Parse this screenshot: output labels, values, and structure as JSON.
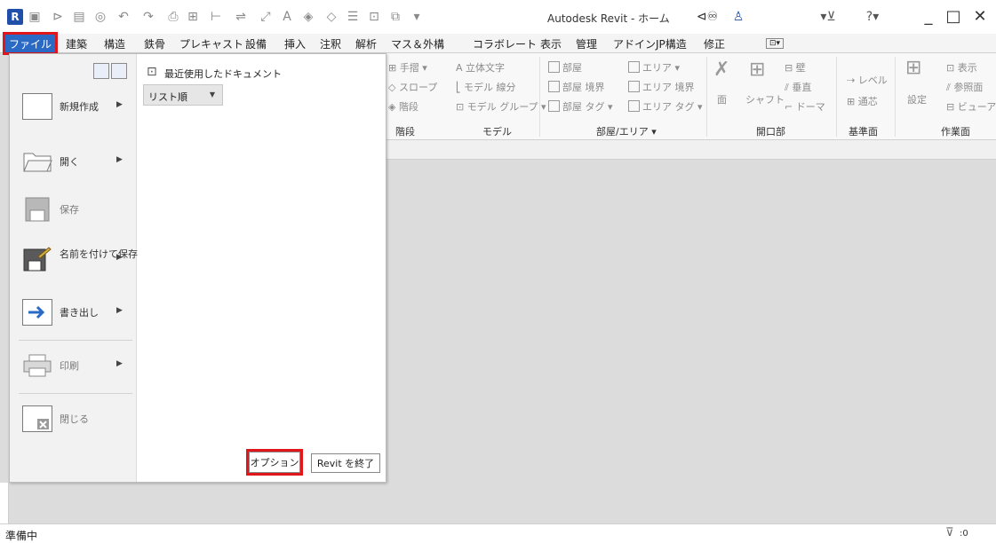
{
  "titlebar": {
    "app_title": "Autodesk Revit - ホーム",
    "app_logo_letter": "R",
    "icons": [
      "new-icon",
      "open-icon",
      "save-icon",
      "sync-icon",
      "undo-icon",
      "redo-icon",
      "print-icon",
      "measure-icon",
      "align-icon",
      "dimension-icon",
      "text-icon",
      "3d-view-icon",
      "section-icon",
      "thin-lines-icon",
      "switch-windows-icon",
      "binoculars-icon",
      "user-icon",
      "cart-icon",
      "help-icon"
    ],
    "minimize": "_",
    "maximize": "□",
    "close": "✕"
  },
  "menubar": {
    "tabs": [
      "ファイル",
      "建築",
      "構造",
      "鉄骨",
      "プレキャスト",
      "設備",
      "挿入",
      "注釈",
      "解析",
      "マス＆外構",
      "コラボレート",
      "表示",
      "管理",
      "アドイン",
      "JP構造",
      "修正"
    ]
  },
  "ribbon": {
    "items": [
      "手摺",
      "スロープ",
      "階段",
      "立体文字",
      "モデル 線分",
      "モデル グループ",
      "部屋",
      "部屋 境界",
      "部屋 タグ",
      "エリア",
      "エリア 境界",
      "エリア タグ",
      "面",
      "シャフト",
      "壁",
      "垂直",
      "ドーマ",
      "レベル",
      "通芯",
      "設定",
      "表示",
      "参照面",
      "ビューア"
    ],
    "groups": [
      "階段",
      "モデル",
      "部屋/エリア ▾",
      "開口部",
      "基準面",
      "作業面"
    ]
  },
  "file_menu": {
    "items": [
      {
        "label": "新規作成",
        "has_arrow": true
      },
      {
        "label": "開く",
        "has_arrow": true
      },
      {
        "label": "保存",
        "has_arrow": false
      },
      {
        "label": "名前を付けて保存",
        "has_arrow": true
      },
      {
        "label": "書き出し",
        "has_arrow": true
      },
      {
        "label": "印刷",
        "has_arrow": true
      },
      {
        "label": "閉じる",
        "has_arrow": false
      }
    ],
    "recent_title": "最近使用したドキュメント",
    "sort_value": "リスト順",
    "options_label": "オプション",
    "exit_label": "Revit を終了"
  },
  "status": {
    "text": "準備中",
    "filter_count": ":0"
  },
  "colors": {
    "accent": "#2b6ac4",
    "highlight": "#e0161b"
  }
}
